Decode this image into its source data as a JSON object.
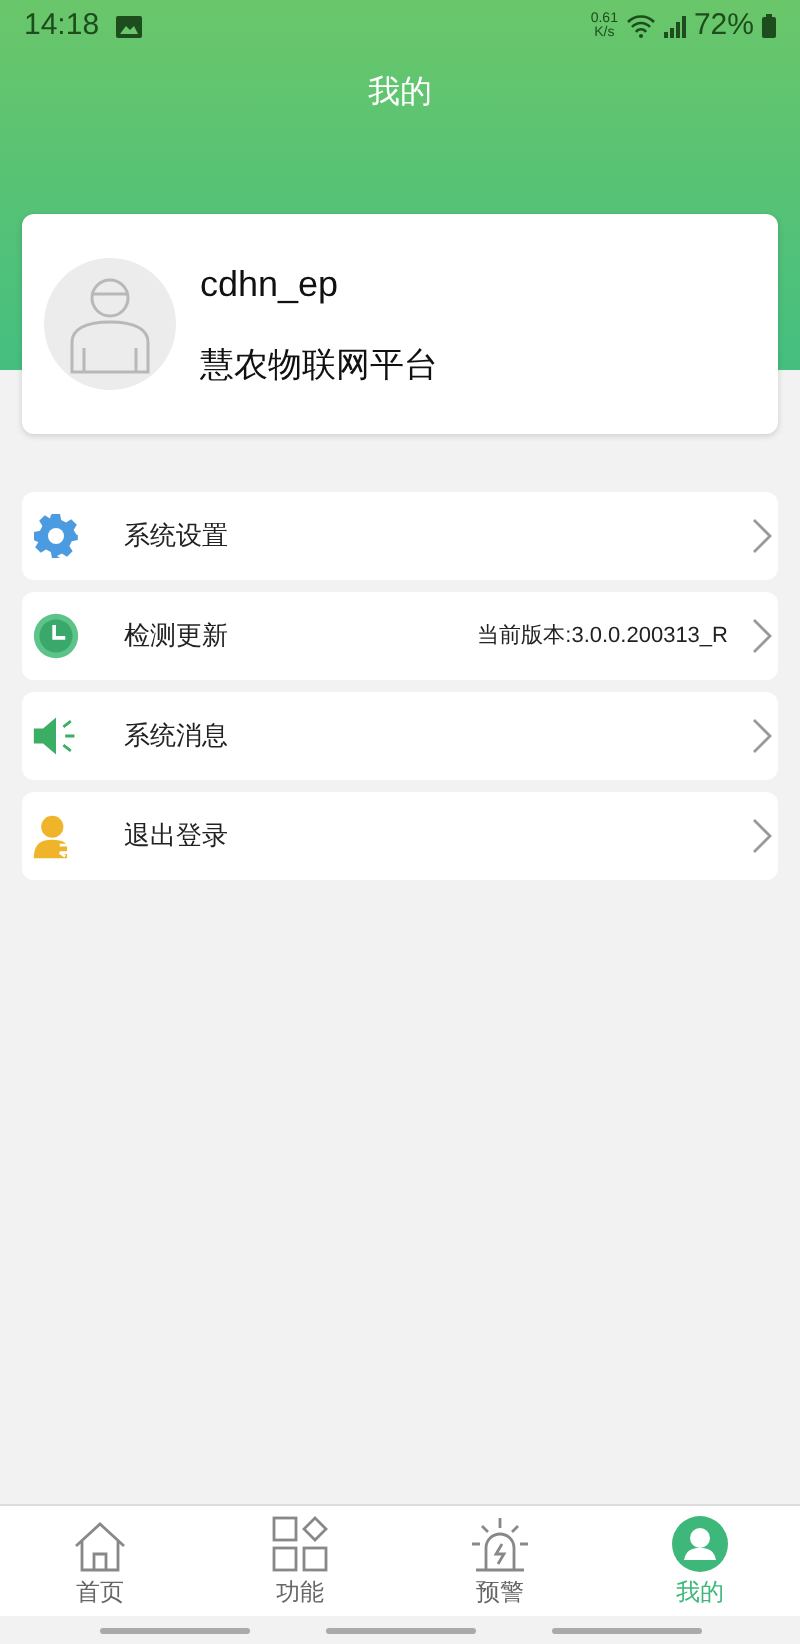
{
  "status_bar": {
    "time": "14:18",
    "net_speed_value": "0.61",
    "net_speed_unit": "K/s",
    "battery": "72%"
  },
  "header": {
    "title": "我的"
  },
  "profile": {
    "username": "cdhn_ep",
    "platform": "慧农物联网平台"
  },
  "menu": [
    {
      "kind": "settings",
      "label": "系统设置"
    },
    {
      "kind": "update",
      "label": "检测更新",
      "detail": "当前版本:3.0.0.200313_R"
    },
    {
      "kind": "message",
      "label": "系统消息"
    },
    {
      "kind": "logout",
      "label": "退出登录"
    }
  ],
  "tabs": [
    {
      "kind": "home",
      "label": "首页",
      "selected": false
    },
    {
      "kind": "functions",
      "label": "功能",
      "selected": false
    },
    {
      "kind": "alert",
      "label": "预警",
      "selected": false
    },
    {
      "kind": "me",
      "label": "我的",
      "selected": true
    }
  ]
}
